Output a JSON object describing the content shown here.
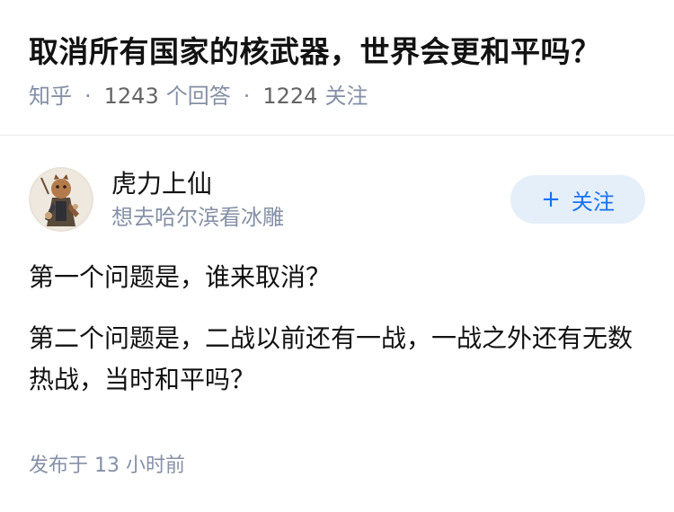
{
  "question": {
    "title": "取消所有国家的核武器，世界会更和平吗？",
    "source": "知乎",
    "answer_count": "1243",
    "answer_label": "个回答",
    "follower_count": "1224",
    "follower_label": "关注"
  },
  "answer": {
    "author": {
      "name": "虎力上仙",
      "bio": "想去哈尔滨看冰雕",
      "avatar_icon": "avatar-illustration"
    },
    "follow_button": {
      "icon": "plus-icon",
      "plus": "+",
      "label": "关注"
    },
    "paragraphs": [
      "第一个问题是，谁来取消？",
      "第二个问题是，二战以前还有一战，一战之外还有无数热战，当时和平吗？"
    ],
    "time_prefix": "发布于",
    "time_value": "13 小时前"
  },
  "colors": {
    "text_primary": "#121212",
    "text_secondary": "#8590a6",
    "follow_bg": "#e5eff9",
    "follow_fg": "#1772f6"
  }
}
